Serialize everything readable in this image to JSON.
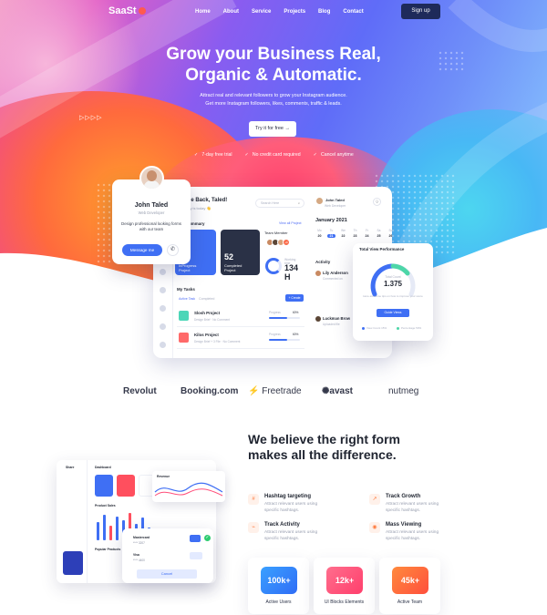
{
  "nav": {
    "logo": "SaaSt",
    "items": [
      "Home",
      "About",
      "Service",
      "Projects",
      "Blog",
      "Contact"
    ],
    "signup": "Sign up"
  },
  "hero": {
    "title_line1": "Grow your Business Real,",
    "title_line2": "Organic & Automatic.",
    "subtitle_line1": "Attract real and relevant followers to grow your Instagram audience.",
    "subtitle_line2": "Get more Instagram followers, likes, comments, traffic & leads.",
    "cta": "Try it for free",
    "checks": [
      "7-day free trial",
      "No credit card required",
      "Cancel anytime"
    ]
  },
  "profile": {
    "name": "John Taled",
    "role": "Web Developer",
    "description": "Design professional looking forms with our team",
    "message_button": "Message me"
  },
  "dashboard": {
    "greeting": "me Back, Taled!",
    "greeting_sub": "day is today 👋",
    "search_placeholder": "Search Here",
    "user_name": "John Taled",
    "user_role": "Web Developer",
    "summary_title": "Summary",
    "summary_all": "View all Project",
    "cards": [
      {
        "number": "",
        "label": "InProgress\nProject"
      },
      {
        "number": "52",
        "label": "Completed\nProject"
      }
    ],
    "team_member": "Team Member",
    "team_more": "+9",
    "working_hours_label": "Working time",
    "working_hours": "134 H",
    "tasks_title": "My Tasks",
    "tab_active": "Active Task",
    "tab_completed": "Completed",
    "create_button": "+ Create",
    "task_rows": [
      {
        "name": "Slosh Project",
        "meta": "Design Brief",
        "comments": "No Comment",
        "progress_label": "Progress",
        "progress": "60%",
        "progress_value": 0.6
      },
      {
        "name": "Kilos Project",
        "meta": "Design Brief + 3 File",
        "comments": "No Comment",
        "progress_label": "Progress",
        "progress": "60%",
        "progress_value": 0.6
      }
    ],
    "calendar_title": "January 2021",
    "calendar": [
      {
        "d": "Mo",
        "n": "20"
      },
      {
        "d": "Tu",
        "n": "21"
      },
      {
        "d": "We",
        "n": "22"
      },
      {
        "d": "Th",
        "n": "23"
      },
      {
        "d": "Fr",
        "n": "24"
      },
      {
        "d": "Sa",
        "n": "25"
      },
      {
        "d": "Su",
        "n": "26"
      }
    ],
    "activity_title": "Activity",
    "activities": [
      {
        "name": "Lily Anderson",
        "sub": "Commented on"
      },
      {
        "name": "Luckman Brow",
        "sub": "Uploaded file"
      }
    ]
  },
  "total_view": {
    "title": "Total View Performance",
    "caption": "Total Count",
    "number": "1.375",
    "description": "Here are some tips on how to improve your score",
    "button": "Guide Views",
    "legend": [
      "View Count 15%",
      "Percentage 50%"
    ],
    "legend_colors": [
      "#3f6ff4",
      "#4dd6a8"
    ]
  },
  "partners": [
    "Revolut",
    "Booking.com",
    "Freetrade",
    "avast",
    "nutmeg"
  ],
  "features": {
    "title": "We believe the right form makes all the difference.",
    "items": [
      {
        "name": "Hashtag targeting",
        "desc": "Attract relevant users using specific hashtags.",
        "icon": "hashtag-icon",
        "color": "#ff7a3d"
      },
      {
        "name": "Track Growth",
        "desc": "Attract relevant users using specific hashtags.",
        "icon": "growth-icon",
        "color": "#ff7a3d"
      },
      {
        "name": "Track Activity",
        "desc": "Attract relevant users using specific hashtags.",
        "icon": "activity-icon",
        "color": "#ff7a3d"
      },
      {
        "name": "Mass Viewing",
        "desc": "Attract relevant users using specific hashtags.",
        "icon": "eye-icon",
        "color": "#ff7a3d"
      }
    ],
    "stats": [
      {
        "value": "100k+",
        "label": "Active Users",
        "color": "#2f7df6"
      },
      {
        "value": "12k+",
        "label": "UI Blocks Elements",
        "color": "#ff4f7b"
      },
      {
        "value": "45k+",
        "label": "Active Team",
        "color": "#ff6a2e"
      }
    ]
  },
  "mockup": {
    "app_name": "Share",
    "dashboard_label": "Dashboard",
    "product_sales": "Product Sales",
    "popular_products": "Popular Products",
    "pay_card": "Mastercard",
    "pay_card_num": "**** 3207",
    "pay_visa": "Visa",
    "pay_visa_num": "**** 4400",
    "cancel": "Cancel",
    "graph_label": "Revenue"
  }
}
